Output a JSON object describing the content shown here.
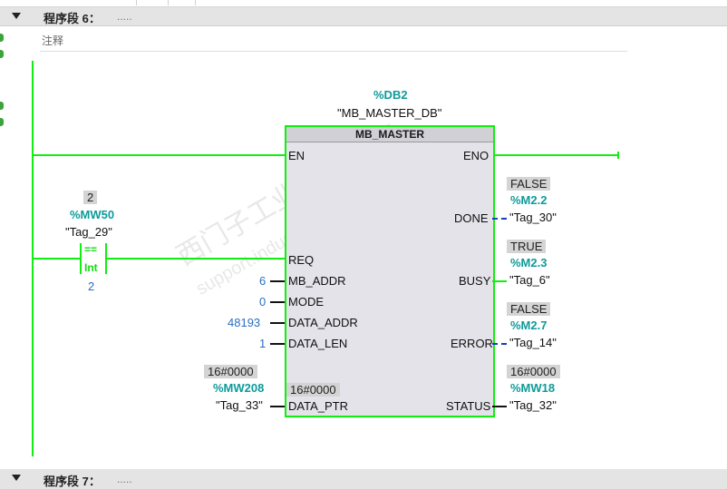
{
  "network6": {
    "title": "程序段 6：",
    "dots": "....."
  },
  "network7": {
    "title": "程序段 7：",
    "dots": "....."
  },
  "comment": "注释",
  "block": {
    "db_address": "%DB2",
    "db_name": "\"MB_MASTER_DB\"",
    "type": "MB_MASTER",
    "inputs": {
      "en": "EN",
      "req": "REQ",
      "mb_addr": "MB_ADDR",
      "mode": "MODE",
      "data_addr": "DATA_ADDR",
      "data_len": "DATA_LEN",
      "data_ptr": "DATA_PTR"
    },
    "outputs": {
      "eno": "ENO",
      "done": "DONE",
      "busy": "BUSY",
      "error": "ERROR",
      "status": "STATUS"
    },
    "data_ptr_value": "16#0000"
  },
  "input_values": {
    "mb_addr": "6",
    "mode": "0",
    "data_addr": "48193",
    "data_len": "1",
    "data_ptr_monitor": "16#0000",
    "data_ptr_addr": "%MW208",
    "data_ptr_tag": "\"Tag_33\""
  },
  "outputs_values": {
    "done": {
      "monitor": "FALSE",
      "addr": "%M2.2",
      "tag": "\"Tag_30\""
    },
    "busy": {
      "monitor": "TRUE",
      "addr": "%M2.3",
      "tag": "\"Tag_6\""
    },
    "error": {
      "monitor": "FALSE",
      "addr": "%M2.7",
      "tag": "\"Tag_14\""
    },
    "status": {
      "monitor": "16#0000",
      "addr": "%MW18",
      "tag": "\"Tag_32\""
    }
  },
  "compare": {
    "monitor": "2",
    "addr": "%MW50",
    "tag": "\"Tag_29\"",
    "op": "==",
    "type": "Int",
    "value": "2"
  },
  "watermark": {
    "line1": "西门子工业 技术论坛",
    "line2": "support.industry.siemens.com/cs"
  },
  "colors": {
    "energized": "#11ee11",
    "address": "#0f9a9a",
    "constant": "#2a6fc0",
    "header": "#e4e4e4"
  }
}
